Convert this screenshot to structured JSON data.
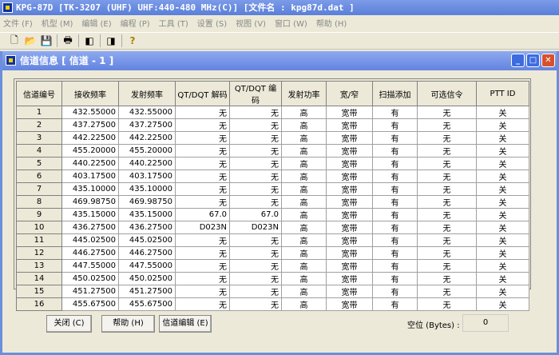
{
  "window": {
    "title": "KPG-87D [TK-3207 (UHF) UHF:440-480 MHz(C)] [文件名 : kpg87d.dat ]"
  },
  "menu": [
    "文件 (F)",
    "机型 (M)",
    "编辑 (E)",
    "编程 (P)",
    "工具 (T)",
    "设置 (S)",
    "视图 (V)",
    "窗口 (W)",
    "帮助 (H)"
  ],
  "toolbar": [
    {
      "icon": "new-file-icon",
      "glyph": "🗋"
    },
    {
      "icon": "open-folder-icon",
      "glyph": "📂"
    },
    {
      "icon": "save-icon",
      "glyph": "💾"
    },
    {
      "icon": "print-icon",
      "glyph": "🖶"
    },
    {
      "icon": "read-radio-icon",
      "glyph": "◧"
    },
    {
      "icon": "write-radio-icon",
      "glyph": "◨"
    },
    {
      "icon": "help-icon",
      "glyph": "?"
    }
  ],
  "child": {
    "title": "信道信息 [ 信道 - 1 ]"
  },
  "table": {
    "headers": [
      "信道编号",
      "接收频率",
      "发射频率",
      "QT/DQT 解码",
      "QT/DQT 编码",
      "发射功率",
      "宽/窄",
      "扫描添加",
      "可选信令",
      "PTT ID"
    ],
    "rows": [
      [
        "1",
        "432.55000",
        "432.55000",
        "无",
        "无",
        "高",
        "宽带",
        "有",
        "无",
        "关"
      ],
      [
        "2",
        "437.27500",
        "437.27500",
        "无",
        "无",
        "高",
        "宽带",
        "有",
        "无",
        "关"
      ],
      [
        "3",
        "442.22500",
        "442.22500",
        "无",
        "无",
        "高",
        "宽带",
        "有",
        "无",
        "关"
      ],
      [
        "4",
        "455.20000",
        "455.20000",
        "无",
        "无",
        "高",
        "宽带",
        "有",
        "无",
        "关"
      ],
      [
        "5",
        "440.22500",
        "440.22500",
        "无",
        "无",
        "高",
        "宽带",
        "有",
        "无",
        "关"
      ],
      [
        "6",
        "403.17500",
        "403.17500",
        "无",
        "无",
        "高",
        "宽带",
        "有",
        "无",
        "关"
      ],
      [
        "7",
        "435.10000",
        "435.10000",
        "无",
        "无",
        "高",
        "宽带",
        "有",
        "无",
        "关"
      ],
      [
        "8",
        "469.98750",
        "469.98750",
        "无",
        "无",
        "高",
        "宽带",
        "有",
        "无",
        "关"
      ],
      [
        "9",
        "435.15000",
        "435.15000",
        "67.0",
        "67.0",
        "高",
        "宽带",
        "有",
        "无",
        "关"
      ],
      [
        "10",
        "436.27500",
        "436.27500",
        "D023N",
        "D023N",
        "高",
        "宽带",
        "有",
        "无",
        "关"
      ],
      [
        "11",
        "445.02500",
        "445.02500",
        "无",
        "无",
        "高",
        "宽带",
        "有",
        "无",
        "关"
      ],
      [
        "12",
        "446.27500",
        "446.27500",
        "无",
        "无",
        "高",
        "宽带",
        "有",
        "无",
        "关"
      ],
      [
        "13",
        "447.55000",
        "447.55000",
        "无",
        "无",
        "高",
        "宽带",
        "有",
        "无",
        "关"
      ],
      [
        "14",
        "450.02500",
        "450.02500",
        "无",
        "无",
        "高",
        "宽带",
        "有",
        "无",
        "关"
      ],
      [
        "15",
        "451.27500",
        "451.27500",
        "无",
        "无",
        "高",
        "宽带",
        "有",
        "无",
        "关"
      ],
      [
        "16",
        "455.67500",
        "455.67500",
        "无",
        "无",
        "高",
        "宽带",
        "有",
        "无",
        "关"
      ]
    ]
  },
  "buttons": {
    "close": "关闭 (C)",
    "help": "帮助 (H)",
    "edit": "信道编辑 (E)"
  },
  "free": {
    "label": "空位 (Bytes) :",
    "value": "0"
  }
}
